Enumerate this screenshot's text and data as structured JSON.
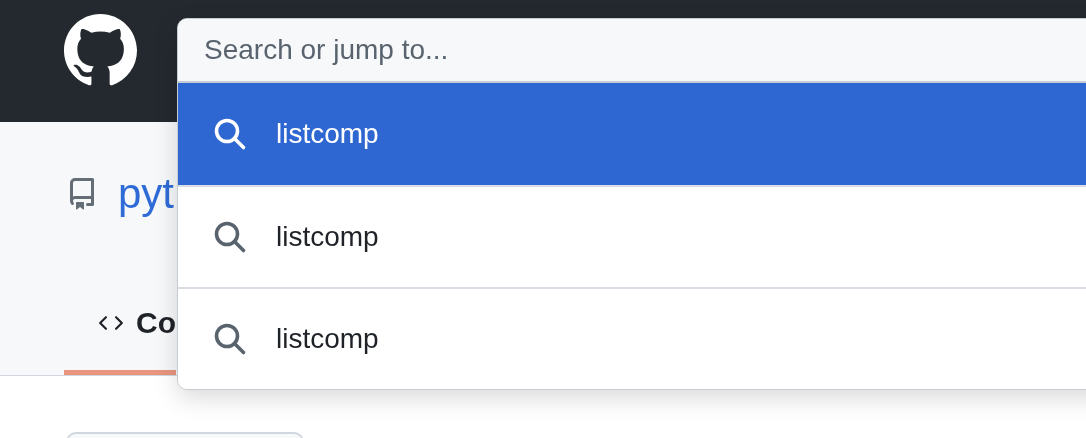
{
  "repo": {
    "name": "pyt"
  },
  "tabs": [
    {
      "label": "Co",
      "selected": true
    }
  ],
  "search": {
    "placeholder": "Search or jump to..."
  },
  "suggestions": [
    {
      "text": "listcomp",
      "selected": true
    },
    {
      "text": "listcomp",
      "selected": false
    },
    {
      "text": "listcomp",
      "selected": false
    }
  ]
}
